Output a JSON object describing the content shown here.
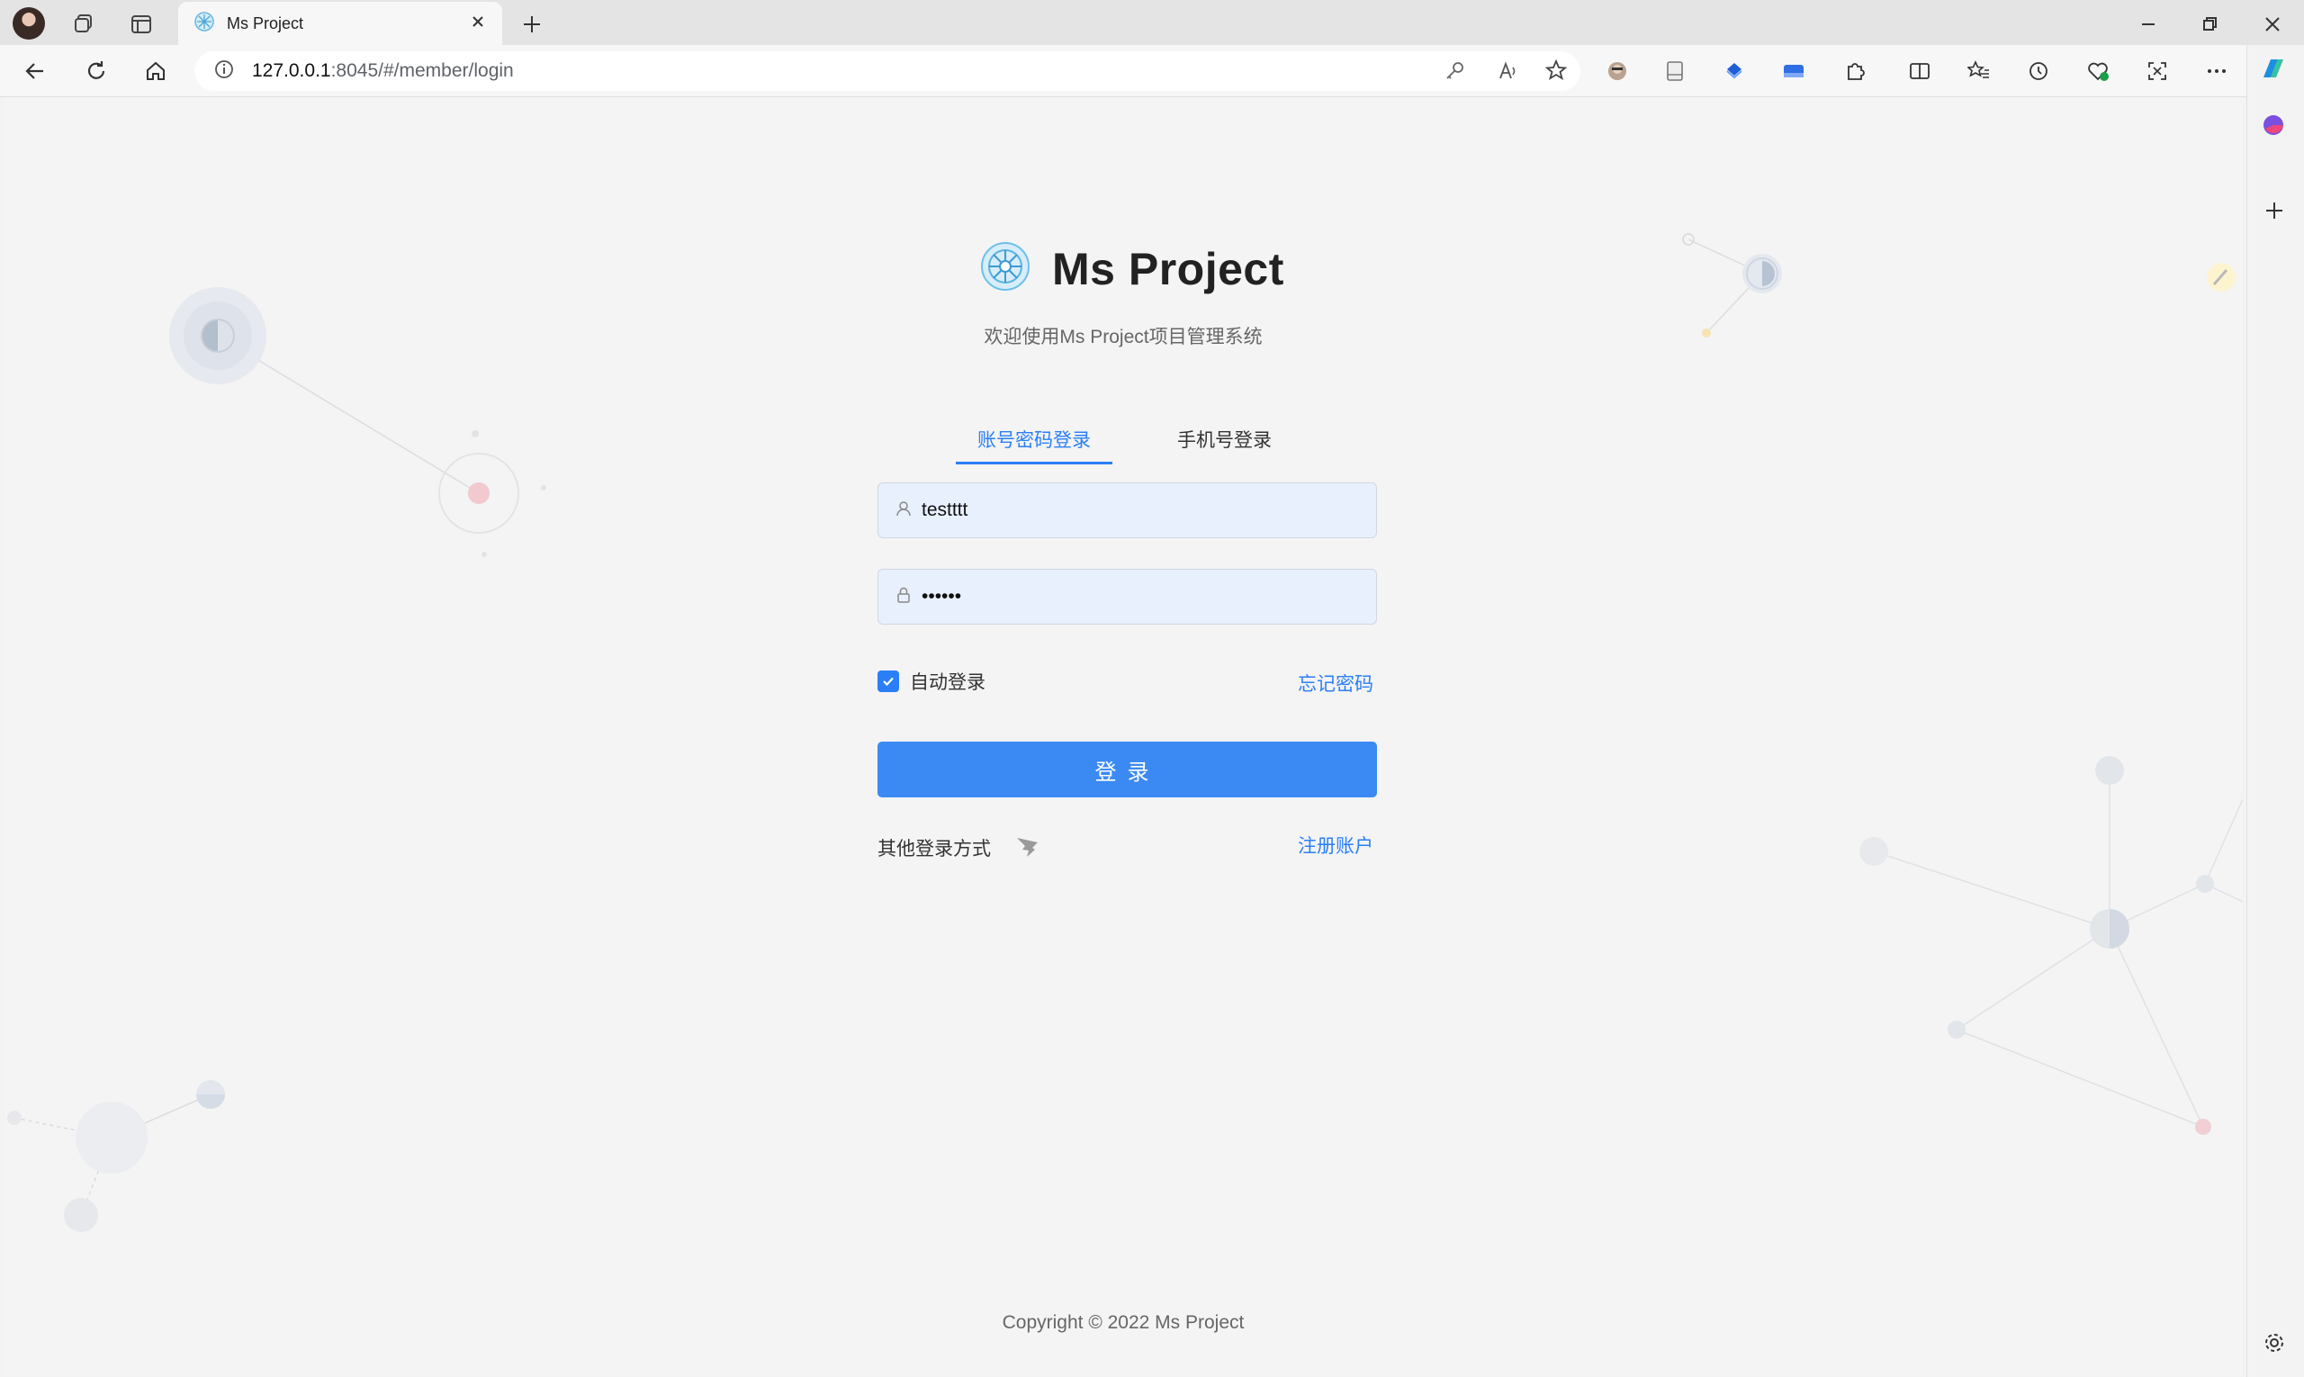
{
  "browser": {
    "tab_title": "Ms Project",
    "url_host": "127.0.0.1",
    "url_rest": ":8045/#/member/login"
  },
  "page": {
    "brand_title": "Ms Project",
    "subtitle": "欢迎使用Ms Project项目管理系统",
    "tabs": [
      {
        "label": "账号密码登录",
        "active": true
      },
      {
        "label": "手机号登录",
        "active": false
      }
    ],
    "username_value": "testttt",
    "password_value": "••••••",
    "remember_label": "自动登录",
    "remember_checked": true,
    "forgot_label": "忘记密码",
    "submit_label": "登录",
    "other_login_label": "其他登录方式",
    "register_label": "注册账户",
    "copyright": "Copyright © 2022 Ms Project"
  },
  "colors": {
    "accent": "#2a7ff7",
    "button": "#3b8af3",
    "input_bg": "#e8f0fe",
    "page_bg": "#f4f4f4"
  }
}
